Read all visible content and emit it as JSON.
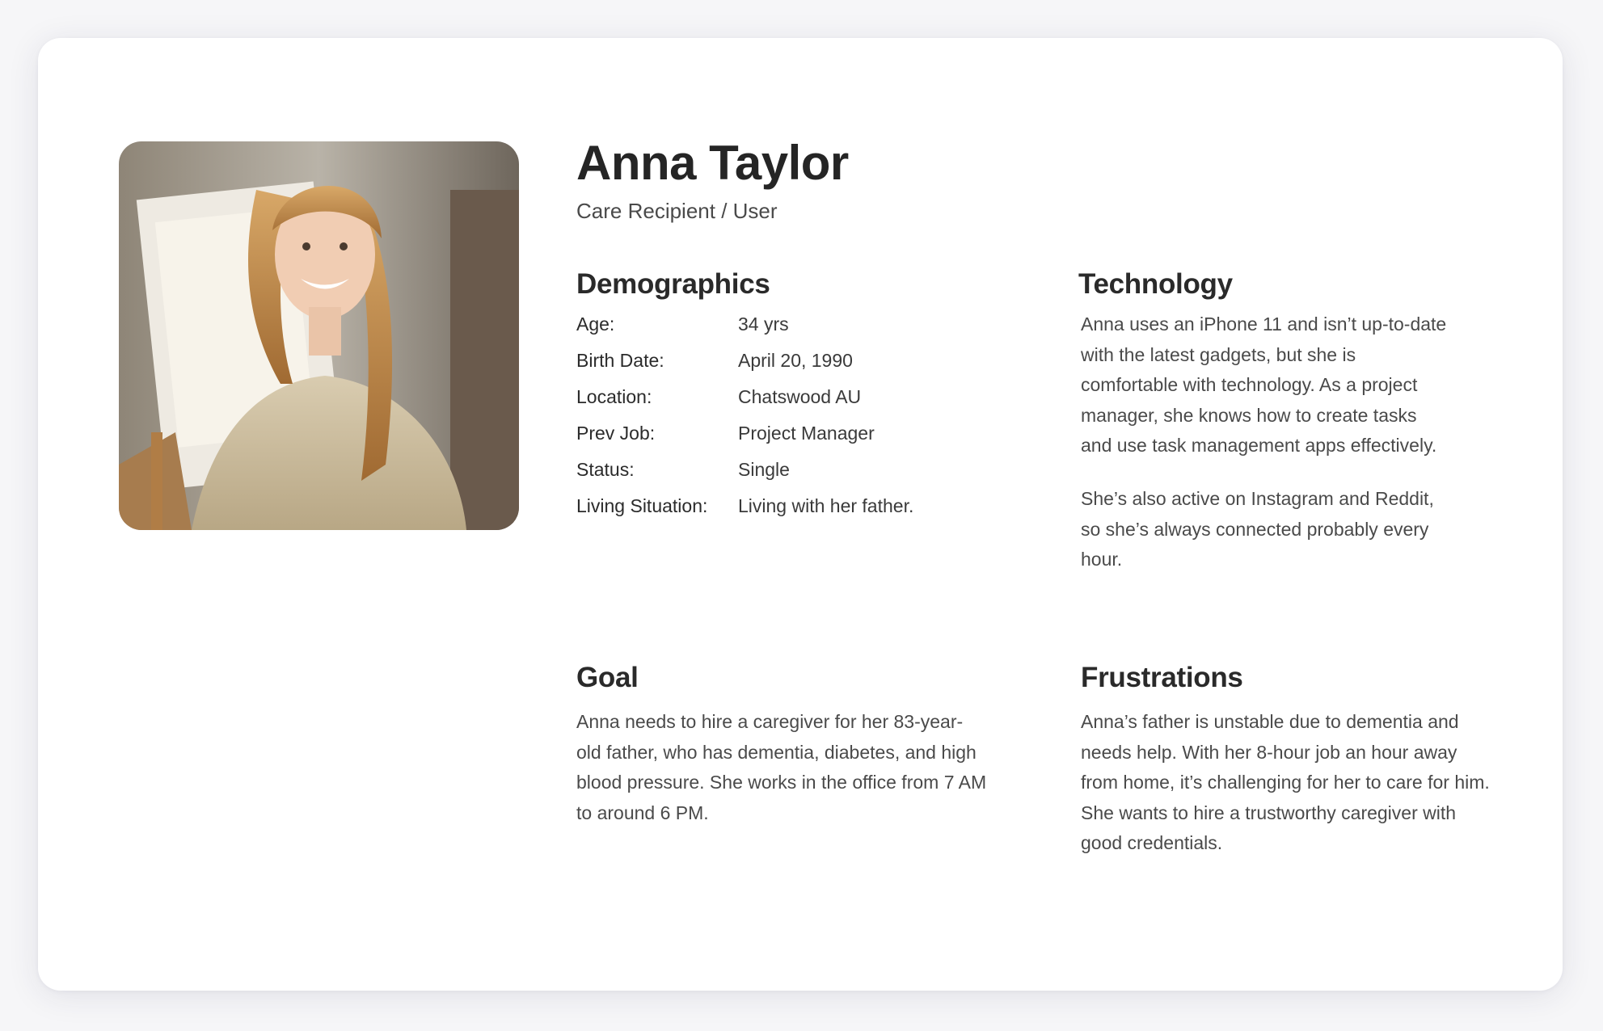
{
  "persona": {
    "name": "Anna Taylor",
    "role": "Care Recipient / User"
  },
  "demographics": {
    "title": "Demographics",
    "rows": [
      {
        "label": "Age:",
        "value": "34 yrs"
      },
      {
        "label": "Birth Date:",
        "value": "April 20, 1990"
      },
      {
        "label": "Location:",
        "value": "Chatswood AU"
      },
      {
        "label": "Prev Job:",
        "value": "Project Manager"
      },
      {
        "label": "Status:",
        "value": "Single"
      },
      {
        "label": "Living Situation:",
        "value": "Living with her father."
      }
    ]
  },
  "technology": {
    "title": "Technology",
    "paragraph1_lines": [
      "Anna uses an iPhone 11 and isn’t up-to-date",
      "with the latest gadgets, but she is",
      "comfortable with technology. As a project",
      "manager, she knows how to create tasks",
      "and use task management apps effectively."
    ],
    "paragraph2_lines": [
      "She’s also active on Instagram and Reddit,",
      "so she’s always connected probably every",
      "hour."
    ]
  },
  "goal": {
    "title": "Goal",
    "lines": [
      "Anna needs to hire a caregiver for her 83-year-",
      "old father, who has dementia, diabetes, and high",
      "blood pressure. She works in the office from 7 AM",
      "to around 6 PM."
    ]
  },
  "frustrations": {
    "title": "Frustrations",
    "lines": [
      "Anna’s father is unstable due to dementia and",
      "needs help. With her 8-hour job an hour away",
      "from home, it’s challenging for her to care for him.",
      "She wants to hire a trustworthy caregiver with",
      "good credentials."
    ]
  },
  "colors": {
    "background": "#f6f6f8",
    "card": "#ffffff",
    "heading": "#252525",
    "body_text": "#4a4a4a"
  }
}
